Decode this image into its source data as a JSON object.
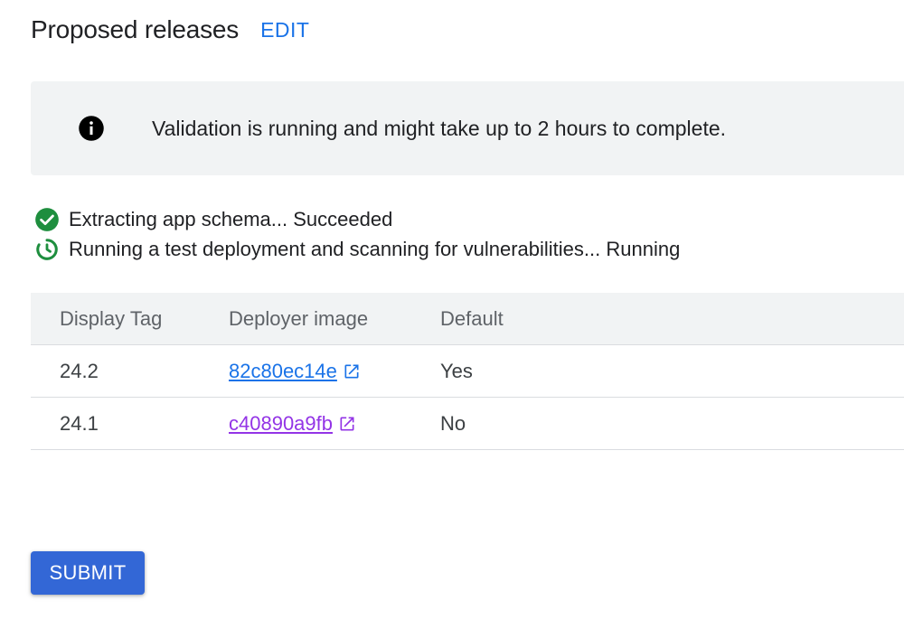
{
  "header": {
    "title": "Proposed releases",
    "edit_label": "EDIT"
  },
  "banner": {
    "icon": "info-icon",
    "message": "Validation is running and might take up to 2 hours to complete."
  },
  "status": [
    {
      "icon": "check-circle-icon",
      "text": "Extracting app schema... Succeeded",
      "color": "#1e8e3e"
    },
    {
      "icon": "progress-circle-icon",
      "text": "Running a test deployment and scanning for vulnerabilities... Running",
      "color": "#1e8e3e"
    }
  ],
  "table": {
    "headers": {
      "display_tag": "Display Tag",
      "deployer_image": "Deployer image",
      "default": "Default"
    },
    "rows": [
      {
        "display_tag": "24.2",
        "deployer_image": "82c80ec14e",
        "default": "Yes",
        "link_state": "unvisited"
      },
      {
        "display_tag": "24.1",
        "deployer_image": "c40890a9fb",
        "default": "No",
        "link_state": "visited"
      }
    ]
  },
  "submit_label": "SUBMIT",
  "colors": {
    "accent": "#1a73e8",
    "visited_link": "#9334e6",
    "submit_bg": "#3367d6",
    "success": "#1e8e3e",
    "banner_bg": "#f1f3f4"
  }
}
